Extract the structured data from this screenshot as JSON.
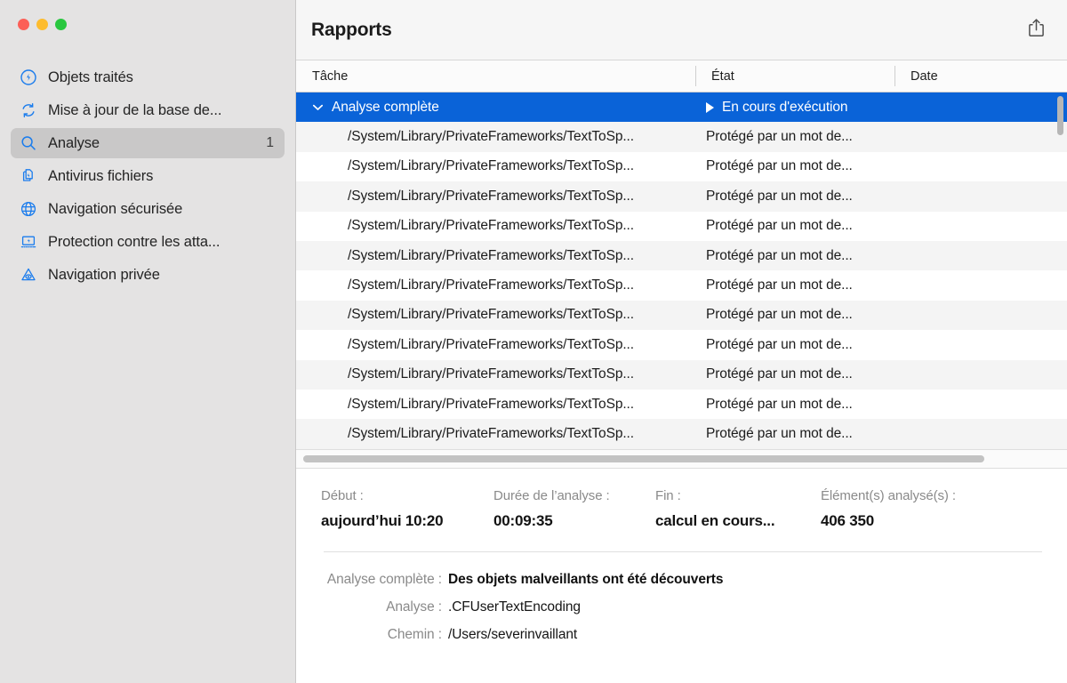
{
  "window": {
    "traffic_lights": [
      "close",
      "minimize",
      "maximize"
    ],
    "colors": {
      "close": "#fc5f57",
      "minimize": "#fdbc2e",
      "maximize": "#29c73f",
      "selection_blue": "#0a63d8",
      "icon_blue": "#1a7ced",
      "sidebar_bg": "#e4e3e3",
      "row_alt": "#f4f4f4"
    }
  },
  "sidebar": {
    "items": [
      {
        "label": "Objets traités",
        "icon": "bolt-circle-icon",
        "badge": "",
        "selected": false
      },
      {
        "label": "Mise à jour de la base de...",
        "icon": "refresh-icon",
        "badge": "",
        "selected": false
      },
      {
        "label": "Analyse",
        "icon": "search-icon",
        "badge": "1",
        "selected": true
      },
      {
        "label": "Antivirus fichiers",
        "icon": "file-shield-icon",
        "badge": "",
        "selected": false
      },
      {
        "label": "Navigation sécurisée",
        "icon": "globe-icon",
        "badge": "",
        "selected": false
      },
      {
        "label": "Protection contre les atta...",
        "icon": "laptop-shield-icon",
        "badge": "",
        "selected": false
      },
      {
        "label": "Navigation privée",
        "icon": "eye-triangle-icon",
        "badge": "",
        "selected": false
      }
    ]
  },
  "header": {
    "title": "Rapports",
    "share_icon": "share-icon"
  },
  "table": {
    "columns": [
      "Tâche",
      "État",
      "Date"
    ],
    "group_row": {
      "task": "Analyse complète",
      "state": "En cours d'exécution",
      "date": "",
      "expanded": true,
      "chevron_icon": "chevron-down-icon",
      "state_icon": "play-icon"
    },
    "rows": [
      {
        "task": "/System/Library/PrivateFrameworks/TextToSp...",
        "state": "Protégé par un mot de...",
        "date": ""
      },
      {
        "task": "/System/Library/PrivateFrameworks/TextToSp...",
        "state": "Protégé par un mot de...",
        "date": ""
      },
      {
        "task": "/System/Library/PrivateFrameworks/TextToSp...",
        "state": "Protégé par un mot de...",
        "date": ""
      },
      {
        "task": "/System/Library/PrivateFrameworks/TextToSp...",
        "state": "Protégé par un mot de...",
        "date": ""
      },
      {
        "task": "/System/Library/PrivateFrameworks/TextToSp...",
        "state": "Protégé par un mot de...",
        "date": ""
      },
      {
        "task": "/System/Library/PrivateFrameworks/TextToSp...",
        "state": "Protégé par un mot de...",
        "date": ""
      },
      {
        "task": "/System/Library/PrivateFrameworks/TextToSp...",
        "state": "Protégé par un mot de...",
        "date": ""
      },
      {
        "task": "/System/Library/PrivateFrameworks/TextToSp...",
        "state": "Protégé par un mot de...",
        "date": ""
      },
      {
        "task": "/System/Library/PrivateFrameworks/TextToSp...",
        "state": "Protégé par un mot de...",
        "date": ""
      },
      {
        "task": "/System/Library/PrivateFrameworks/TextToSp...",
        "state": "Protégé par un mot de...",
        "date": ""
      },
      {
        "task": "/System/Library/PrivateFrameworks/TextToSp...",
        "state": "Protégé par un mot de...",
        "date": ""
      }
    ]
  },
  "detail": {
    "stats": [
      {
        "label": "Début :",
        "value": "aujourd’hui 10:20"
      },
      {
        "label": "Durée de l’analyse :",
        "value": "00:09:35"
      },
      {
        "label": "Fin :",
        "value": "calcul en cours..."
      },
      {
        "label": "Élément(s) analysé(s) :",
        "value": "406 350"
      }
    ],
    "fields": [
      {
        "key": "Analyse complète :",
        "value": "Des objets malveillants ont été découverts"
      },
      {
        "key": "Analyse :",
        "value": ".CFUserTextEncoding"
      },
      {
        "key": "Chemin :",
        "value": "/Users/severinvaillant"
      }
    ]
  }
}
